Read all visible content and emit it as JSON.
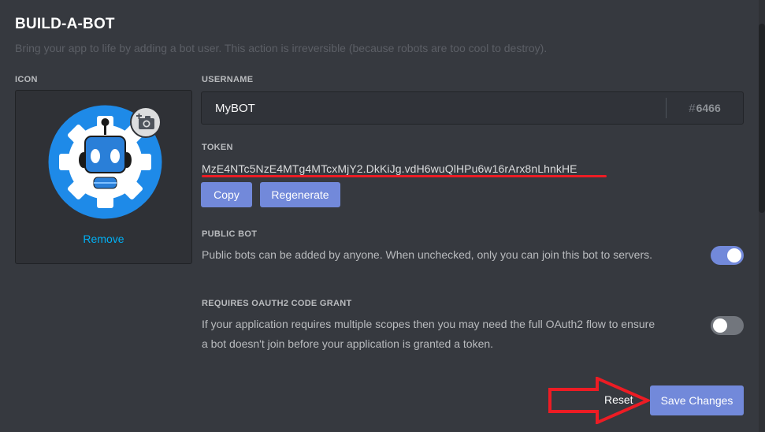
{
  "header": {
    "title": "BUILD-A-BOT",
    "subtitle": "Bring your app to life by adding a bot user. This action is irreversible (because robots are too cool to destroy)."
  },
  "icon_section": {
    "label": "ICON",
    "remove_label": "Remove",
    "camera_icon": "camera-plus-icon",
    "avatar_icon": "robot-gear-icon"
  },
  "username": {
    "label": "USERNAME",
    "value": "MyBOT",
    "discriminator_hash": "#",
    "discriminator": "6466"
  },
  "token": {
    "label": "TOKEN",
    "value": "MzE4NTc5NzE4MTg4MTcxMjY2.DkKiJg.vdH6wuQlHPu6w16rArx8nLhnkHE",
    "copy_label": "Copy",
    "regenerate_label": "Regenerate"
  },
  "public_bot": {
    "label": "PUBLIC BOT",
    "description": "Public bots can be added by anyone. When unchecked, only you can join this bot to servers.",
    "enabled": true
  },
  "oauth2": {
    "label": "REQUIRES OAUTH2 CODE GRANT",
    "description_line1": "If your application requires multiple scopes then you may need the full OAuth2 flow to ensure",
    "description_line2": "a bot doesn't join before your application is granted a token.",
    "enabled": false
  },
  "footer": {
    "reset_label": "Reset",
    "save_label": "Save Changes"
  },
  "colors": {
    "background": "#36393f",
    "accent": "#7289da",
    "link": "#00b0f4",
    "annotation_red": "#ed1c24"
  }
}
